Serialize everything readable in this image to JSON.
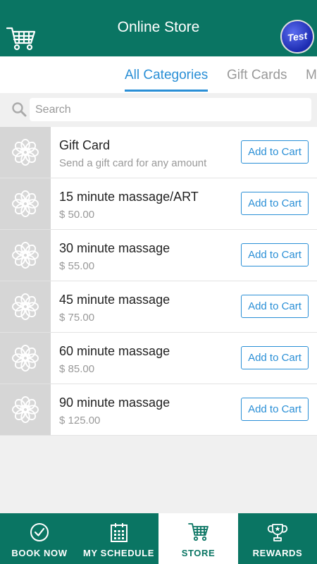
{
  "header": {
    "title": "Online Store",
    "cart_icon": "shopping-cart-icon",
    "avatar_text": "Test"
  },
  "tabs": [
    {
      "label": "All Categories",
      "active": true
    },
    {
      "label": "Gift Cards",
      "active": false
    },
    {
      "label": "M",
      "active": false
    }
  ],
  "search": {
    "placeholder": "Search",
    "value": ""
  },
  "products": [
    {
      "name": "Gift Card",
      "sub": "Send a gift card for any amount",
      "button": "Add to Cart"
    },
    {
      "name": "15 minute massage/ART",
      "sub": "$ 50.00",
      "button": "Add to Cart"
    },
    {
      "name": "30 minute massage",
      "sub": "$ 55.00",
      "button": "Add to Cart"
    },
    {
      "name": "45 minute massage",
      "sub": "$ 75.00",
      "button": "Add to Cart"
    },
    {
      "name": "60 minute massage",
      "sub": "$ 85.00",
      "button": "Add to Cart"
    },
    {
      "name": "90 minute massage",
      "sub": "$ 125.00",
      "button": "Add to Cart"
    }
  ],
  "bottom_nav": [
    {
      "label": "BOOK NOW",
      "icon": "check-circle-icon",
      "active": false
    },
    {
      "label": "MY SCHEDULE",
      "icon": "calendar-icon",
      "active": false
    },
    {
      "label": "STORE",
      "icon": "shopping-cart-icon",
      "active": true
    },
    {
      "label": "REWARDS",
      "icon": "trophy-icon",
      "active": false
    }
  ],
  "colors": {
    "brand": "#0a7563",
    "accent": "#2a8fd6"
  }
}
